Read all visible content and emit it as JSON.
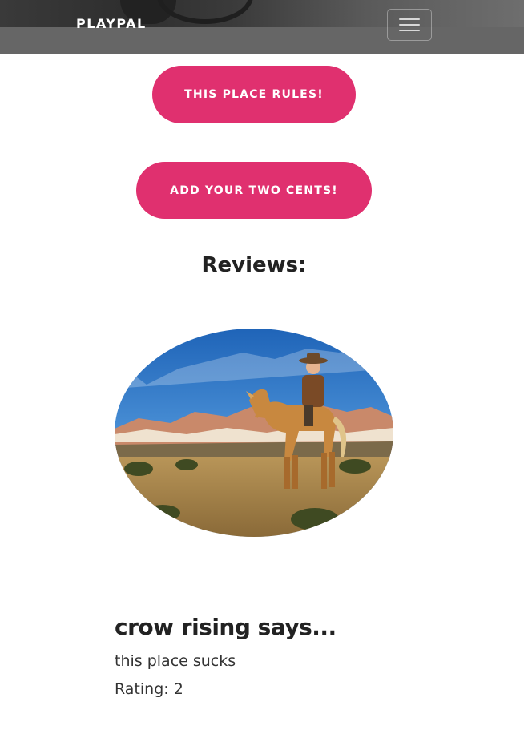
{
  "navbar": {
    "brand": "PLAYPAL",
    "toggler_icon": "hamburger-icon"
  },
  "actions": {
    "rules_button": "THIS PLACE RULES!",
    "add_review_button": "ADD YOUR TWO CENTS!"
  },
  "reviews": {
    "heading": "Reviews:",
    "items": [
      {
        "author_line": "crow rising says...",
        "text": "this place sucks",
        "rating_line": "Rating: 2"
      }
    ]
  },
  "colors": {
    "accent": "#e0306f",
    "navbar_bg": "#5a5a5a",
    "heading_text": "#222222"
  }
}
